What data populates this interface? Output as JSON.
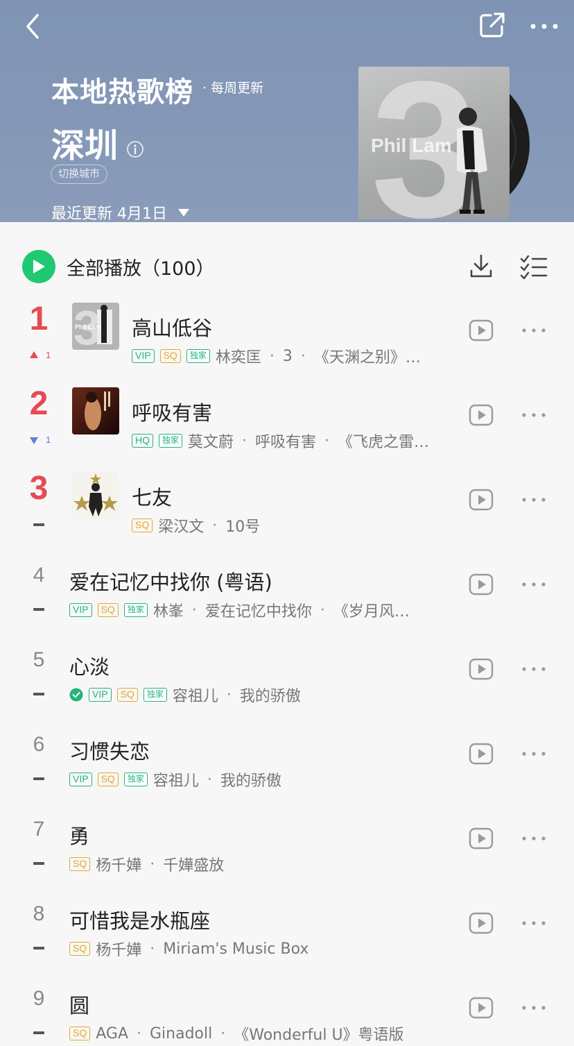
{
  "header": {
    "title": "本地热歌榜",
    "frequency": "· 每周更新",
    "city": "深圳",
    "switch_city_label": "切换城市",
    "updated_label": "最近更新 4月1日",
    "cover": {
      "digit": "3",
      "artist_text": "Phil Lam"
    },
    "colors": {
      "background": "#8497b6"
    }
  },
  "toolbar": {
    "play_all_label": "全部播放",
    "play_all_count": "（100）",
    "accent": "#1ec971"
  },
  "songs": [
    {
      "rank": "1",
      "change": "1",
      "change_dir": "up",
      "title": "高山低谷",
      "badges": [
        "VIP",
        "SQ",
        "独家"
      ],
      "artist": "林奕匡",
      "album_parts": [
        "3",
        "《天渊之别》…"
      ],
      "has_cover": true
    },
    {
      "rank": "2",
      "change": "1",
      "change_dir": "down",
      "title": "呼吸有害",
      "badges": [
        "HQ",
        "独家"
      ],
      "artist": "莫文蔚",
      "album_parts": [
        "呼吸有害",
        "《飞虎之雷…"
      ],
      "has_cover": true
    },
    {
      "rank": "3",
      "change": "",
      "change_dir": "flat",
      "title": "七友",
      "badges": [
        "SQ"
      ],
      "artist": "梁汉文",
      "album_parts": [
        "10号"
      ],
      "has_cover": true
    },
    {
      "rank": "4",
      "change": "",
      "change_dir": "flat",
      "title": "爱在记忆中找你 (粤语)",
      "badges": [
        "VIP",
        "SQ",
        "独家"
      ],
      "artist": "林峯",
      "album_parts": [
        "爱在记忆中找你",
        "《岁月风…"
      ],
      "has_cover": false
    },
    {
      "rank": "5",
      "change": "",
      "change_dir": "flat",
      "title": "心淡",
      "verified": true,
      "badges": [
        "VIP",
        "SQ",
        "独家"
      ],
      "artist": "容祖儿",
      "album_parts": [
        "我的骄傲"
      ],
      "has_cover": false
    },
    {
      "rank": "6",
      "change": "",
      "change_dir": "flat",
      "title": "习惯失恋",
      "badges": [
        "VIP",
        "SQ",
        "独家"
      ],
      "artist": "容祖儿",
      "album_parts": [
        "我的骄傲"
      ],
      "has_cover": false
    },
    {
      "rank": "7",
      "change": "",
      "change_dir": "flat",
      "title": "勇",
      "badges": [
        "SQ"
      ],
      "artist": "杨千嬅",
      "album_parts": [
        "千嬅盛放"
      ],
      "has_cover": false
    },
    {
      "rank": "8",
      "change": "",
      "change_dir": "flat",
      "title": "可惜我是水瓶座",
      "badges": [
        "SQ"
      ],
      "artist": "杨千嬅",
      "album_parts": [
        "Miriam's Music Box"
      ],
      "has_cover": false
    },
    {
      "rank": "9",
      "change": "",
      "change_dir": "flat",
      "title": "圆",
      "badges": [
        "SQ"
      ],
      "artist": "AGA",
      "album_parts": [
        "Ginadoll",
        "《Wonderful U》粤语版"
      ],
      "has_cover": false
    }
  ]
}
